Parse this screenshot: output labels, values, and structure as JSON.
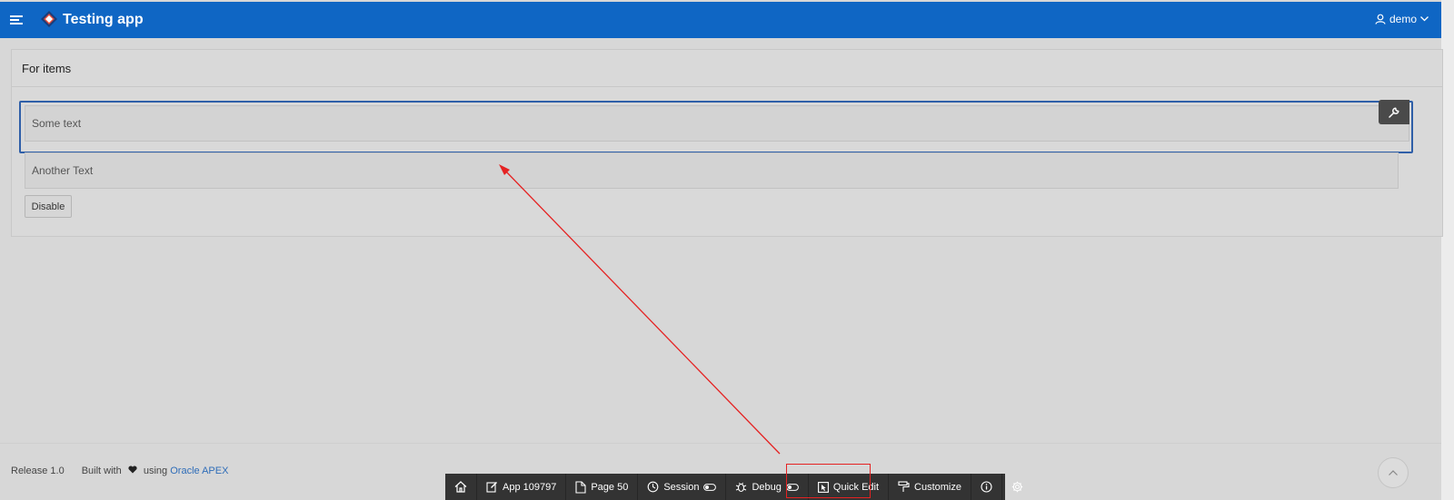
{
  "header": {
    "app_title": "Testing app",
    "user_name": "demo",
    "brand_color": "#0f66c4"
  },
  "region": {
    "title": "For items",
    "items": [
      {
        "value": "Some text"
      },
      {
        "value": "Another Text"
      }
    ],
    "button_label": "Disable"
  },
  "footer": {
    "release": "Release 1.0",
    "built_with_prefix": "Built with",
    "built_with_using": "using",
    "link_text": "Oracle APEX"
  },
  "dev_toolbar": {
    "items": [
      {
        "label": "App 109797",
        "icon": "edit-icon"
      },
      {
        "label": "Page 50",
        "icon": "page-edit-icon"
      },
      {
        "label": "Session",
        "icon": "session-icon"
      },
      {
        "label": "Debug",
        "icon": "bug-icon"
      },
      {
        "label": "Quick Edit",
        "icon": "quick-edit-icon"
      },
      {
        "label": "Customize",
        "icon": "paint-roller-icon"
      }
    ]
  },
  "annotation": {
    "color": "#e52222"
  }
}
